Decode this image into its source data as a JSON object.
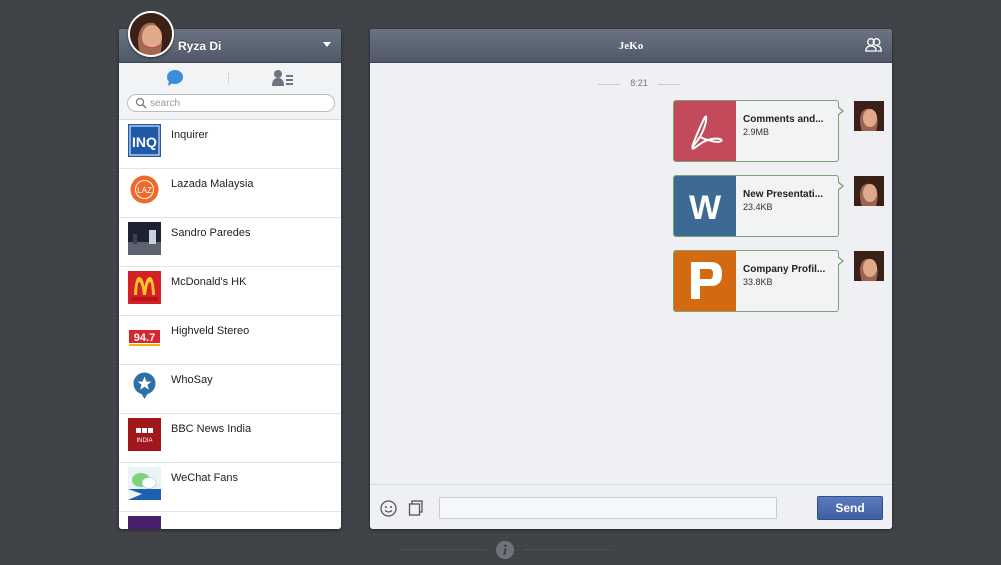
{
  "profile": {
    "name": "Ryza Di"
  },
  "search": {
    "placeholder": "search"
  },
  "contacts": [
    {
      "name": "Inquirer",
      "avatar": "inquirer-logo"
    },
    {
      "name": "Lazada Malaysia",
      "avatar": "lazada-logo"
    },
    {
      "name": "Sandro Paredes",
      "avatar": "photo-avatar"
    },
    {
      "name": "McDonald's HK",
      "avatar": "mcdonalds-logo"
    },
    {
      "name": "Highveld Stereo",
      "avatar": "highveld-logo"
    },
    {
      "name": "WhoSay",
      "avatar": "whosay-logo"
    },
    {
      "name": "BBC News India",
      "avatar": "bbc-logo"
    },
    {
      "name": "WeChat Fans",
      "avatar": "wechat-fans-logo"
    }
  ],
  "chat": {
    "title": "JeKo",
    "timestamp": "8:21",
    "messages": [
      {
        "file_name": "Comments and...",
        "file_size": "2.9MB",
        "file_type": "pdf",
        "icon_color": "#c24a5b"
      },
      {
        "file_name": "New Presentati...",
        "file_size": "23.4KB",
        "file_type": "word",
        "icon_color": "#3d6a93"
      },
      {
        "file_name": "Company Profil...",
        "file_size": "33.8KB",
        "file_type": "pages",
        "icon_color": "#d36a12"
      }
    ]
  },
  "composer": {
    "input_value": "",
    "send_label": "Send"
  },
  "colors": {
    "header_bar": "#5d6674",
    "send_button": "#4a6bb0",
    "bubble_border": "#7fa176"
  }
}
